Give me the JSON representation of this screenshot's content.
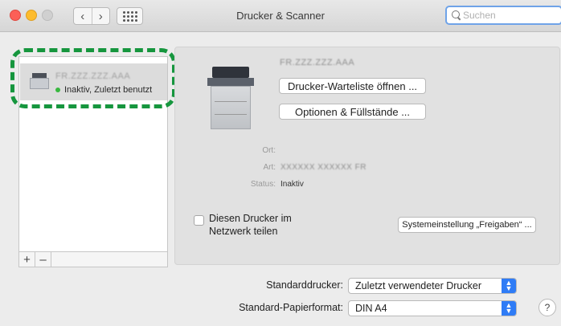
{
  "window": {
    "title": "Drucker & Scanner"
  },
  "toolbar": {
    "back_glyph": "‹",
    "forward_glyph": "›"
  },
  "search": {
    "value": "",
    "placeholder": "Suchen"
  },
  "printer_list": {
    "items": [
      {
        "name": "FR.ZZZ.ZZZ.AAA",
        "status": "Inaktiv, Zuletzt benutzt",
        "status_color": "#38b83f",
        "selected": true
      }
    ],
    "add_label": "+",
    "remove_label": "–"
  },
  "detail": {
    "printer_name": "FR.ZZZ.ZZZ.AAA",
    "queue_button": "Drucker-Warteliste öffnen ...",
    "options_button": "Optionen & Füllstände ...",
    "location_label": "Ort:",
    "location_value": "",
    "kind_label": "Art:",
    "kind_value": "XXXXXX XXXXXX FR",
    "status_label": "Status:",
    "status_value": "Inaktiv",
    "share_checkbox_label": "Diesen Drucker im Netzwerk teilen",
    "share_checked": false,
    "sharing_prefs_button": "Systemeinstellung „Freigaben“ ..."
  },
  "defaults": {
    "default_printer_label": "Standarddrucker:",
    "default_printer_value": "Zuletzt verwendeter Drucker",
    "paper_size_label": "Standard-Papierformat:",
    "paper_size_value": "DIN A4"
  },
  "help_label": "?",
  "colors": {
    "accent": "#2f7cf6",
    "highlight_border": "#16963e",
    "close": "#fc5f57",
    "minimize": "#fdbc2e"
  }
}
